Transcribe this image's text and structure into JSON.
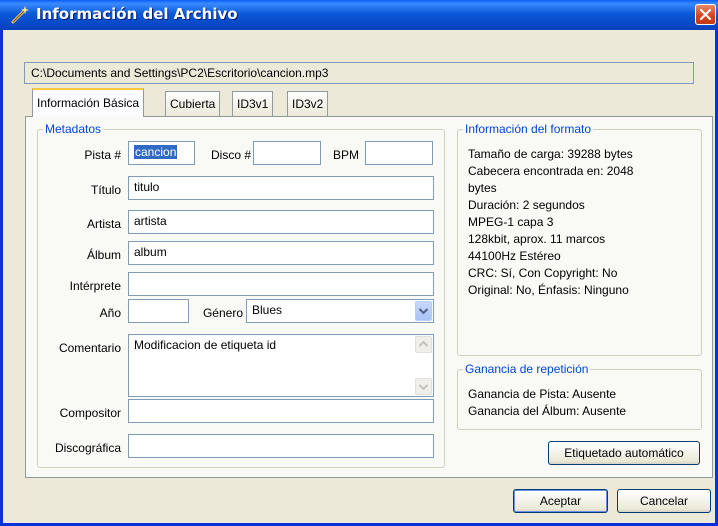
{
  "window": {
    "title": "Información del Archivo"
  },
  "file_path": "C:\\Documents and Settings\\PC2\\Escritorio\\cancion.mp3",
  "tabs": [
    "Información Básica",
    "Cubierta",
    "ID3v1",
    "ID3v2"
  ],
  "metadata": {
    "legend": "Metadatos",
    "track_label": "Pista #",
    "track_value": "cancion",
    "disc_label": "Disco #",
    "disc_value": "",
    "bpm_label": "BPM",
    "bpm_value": "",
    "title_label": "Título",
    "title_value": "titulo",
    "artist_label": "Artista",
    "artist_value": "artista",
    "album_label": "Álbum",
    "album_value": "album",
    "performer_label": "Intérprete",
    "performer_value": "",
    "year_label": "Año",
    "year_value": "",
    "genre_label": "Género",
    "genre_value": "Blues",
    "comment_label": "Comentario",
    "comment_value": "Modificacion de etiqueta id",
    "composer_label": "Compositor",
    "composer_value": "",
    "label_label": "Discográfica",
    "label_value": ""
  },
  "format_info": {
    "legend": "Información del formato",
    "lines": [
      "Tamaño de carga: 39288 bytes",
      "Cabecera encontrada en: 2048",
      "bytes",
      "Duración: 2 segundos",
      "MPEG-1 capa 3",
      "128kbit, aprox. 11 marcos",
      "44100Hz Estéreo",
      "CRC: Sí, Con Copyright: No",
      "Original: No, Énfasis: Ninguno"
    ]
  },
  "replay_gain": {
    "legend": "Ganancia de repetición",
    "track": "Ganancia de Pista: Ausente",
    "album": "Ganancia del Álbum: Ausente"
  },
  "buttons": {
    "auto_tag": "Etiquetado automático",
    "accept": "Aceptar",
    "cancel": "Cancelar"
  },
  "colors": {
    "accent": "#0046d5",
    "selection": "#316ac5",
    "titlebar": "#0a5ad9"
  }
}
